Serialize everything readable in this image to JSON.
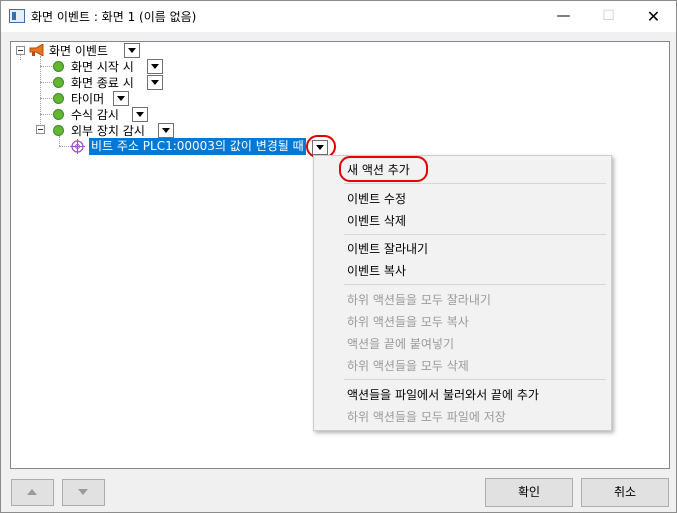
{
  "window": {
    "title": "화면 이벤트 : 화면 1 (이름 없음)",
    "minimize_glyph": "—",
    "maximize_glyph": "☐",
    "close_glyph": "✕"
  },
  "tree": {
    "root": {
      "label": "화면 이벤트",
      "icon": "megaphone-icon"
    },
    "children": [
      {
        "label": "화면 시작 시"
      },
      {
        "label": "화면 종료 시"
      },
      {
        "label": "타이머"
      },
      {
        "label": "수식 감시"
      },
      {
        "label": "외부 장치 감시"
      }
    ],
    "selected_child": {
      "label": "비트 주소 PLC1:00003의 값이 변경될 때",
      "icon": "target-icon"
    }
  },
  "context_menu": {
    "items": [
      {
        "label": "새 액션 추가",
        "enabled": true
      },
      {
        "label": "이벤트 수정",
        "enabled": true
      },
      {
        "label": "이벤트 삭제",
        "enabled": true
      },
      {
        "label": "이벤트 잘라내기",
        "enabled": true
      },
      {
        "label": "이벤트 복사",
        "enabled": true
      },
      {
        "label": "하위 액션들을 모두 잘라내기",
        "enabled": false
      },
      {
        "label": "하위 액션들을 모두 복사",
        "enabled": false
      },
      {
        "label": "액션을 끝에 붙여넣기",
        "enabled": false
      },
      {
        "label": "하위 액션들을 모두 삭제",
        "enabled": false
      },
      {
        "label": "액션들을 파일에서 불러와서 끝에 추가",
        "enabled": true
      },
      {
        "label": "하위 액션들을 모두 파일에 저장",
        "enabled": false
      }
    ]
  },
  "buttons": {
    "ok": "확인",
    "cancel": "취소"
  },
  "colors": {
    "selection": "#0078d7",
    "highlight_circle": "#e00000",
    "status_dot": "#62b832"
  }
}
